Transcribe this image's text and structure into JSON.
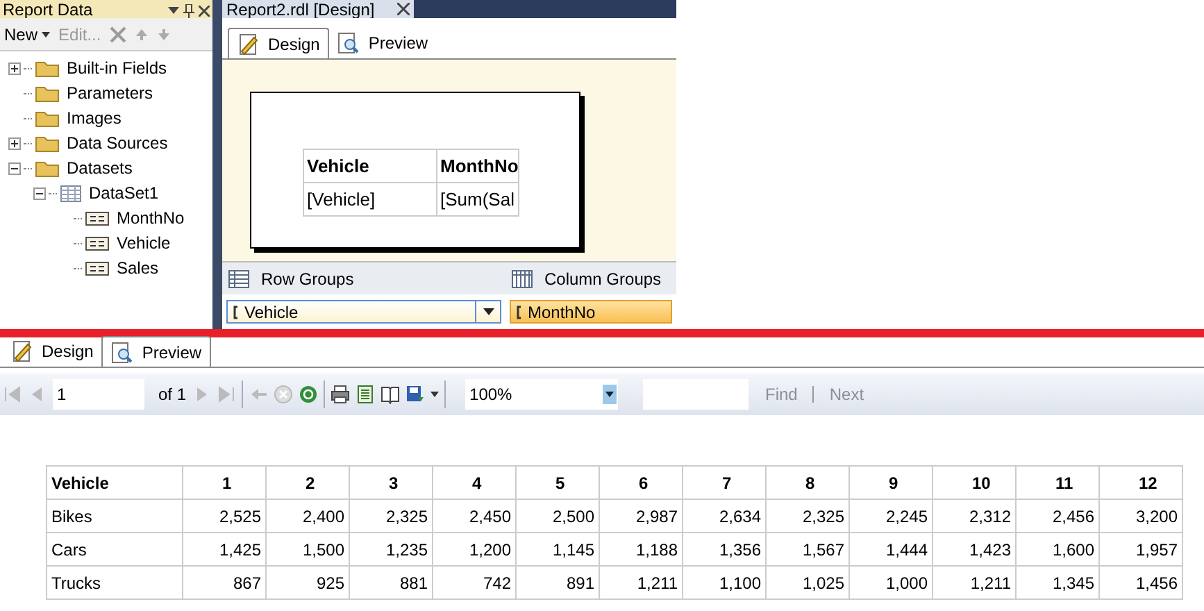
{
  "report_data_panel": {
    "title": "Report Data",
    "toolbar": [
      {
        "kind": "menu",
        "label": "New",
        "disabled": false
      },
      {
        "kind": "text",
        "label": "Edit...",
        "disabled": true
      }
    ],
    "tree": [
      {
        "label": "Built-in Fields",
        "kind": "folder",
        "expanded": false
      },
      {
        "label": "Parameters",
        "kind": "folder"
      },
      {
        "label": "Images",
        "kind": "folder"
      },
      {
        "label": "Data Sources",
        "kind": "folder",
        "expanded": false
      },
      {
        "label": "Datasets",
        "kind": "folder",
        "expanded": true,
        "children": [
          {
            "label": "DataSet1",
            "kind": "dataset",
            "expanded": true,
            "children": [
              {
                "label": "MonthNo",
                "kind": "field"
              },
              {
                "label": "Vehicle",
                "kind": "field"
              },
              {
                "label": "Sales",
                "kind": "field"
              }
            ]
          }
        ]
      }
    ]
  },
  "document_tab": {
    "title": "Report2.rdl [Design]"
  },
  "design_tabs": [
    {
      "label": "Design",
      "selected": true
    },
    {
      "label": "Preview",
      "selected": false
    }
  ],
  "design_tablix": {
    "header": [
      "Vehicle",
      "MonthNo"
    ],
    "row": [
      "[Vehicle]",
      "[Sum(Sal"
    ]
  },
  "row_groups": {
    "title": "Row Groups",
    "group": "Vehicle"
  },
  "column_groups": {
    "title": "Column Groups",
    "group": "MonthNo"
  },
  "preview_tabs": [
    {
      "label": "Design",
      "selected": false
    },
    {
      "label": "Preview",
      "selected": true
    }
  ],
  "preview_toolbar": {
    "page": "1",
    "page_count": "of 1",
    "zoom": "100%",
    "find": {
      "label": "Find",
      "disabled": true
    },
    "next": {
      "label": "Next",
      "disabled": true
    }
  },
  "report_table": {
    "columns": [
      "Vehicle",
      "1",
      "2",
      "3",
      "4",
      "5",
      "6",
      "7",
      "8",
      "9",
      "10",
      "11",
      "12"
    ],
    "rows": [
      [
        "Bikes",
        "2,525",
        "2,400",
        "2,325",
        "2,450",
        "2,500",
        "2,987",
        "2,634",
        "2,325",
        "2,245",
        "2,312",
        "2,456",
        "3,200"
      ],
      [
        "Cars",
        "1,425",
        "1,500",
        "1,235",
        "1,200",
        "1,145",
        "1,188",
        "1,356",
        "1,567",
        "1,444",
        "1,423",
        "1,600",
        "1,957"
      ],
      [
        "Trucks",
        "867",
        "925",
        "881",
        "742",
        "891",
        "1,211",
        "1,100",
        "1,025",
        "1,000",
        "1,211",
        "1,345",
        "1,456"
      ]
    ]
  }
}
